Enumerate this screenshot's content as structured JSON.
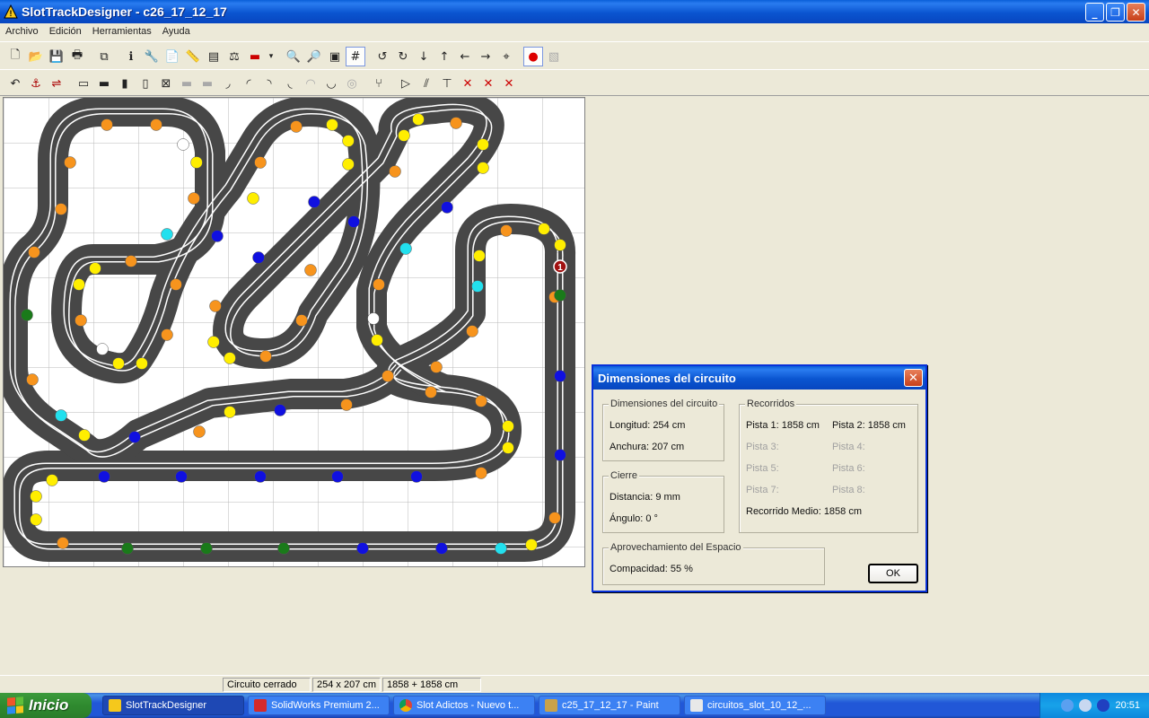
{
  "window": {
    "title": "SlotTrackDesigner - c26_17_12_17"
  },
  "menu": [
    "Archivo",
    "Edición",
    "Herramientas",
    "Ayuda"
  ],
  "toolbar1": [
    "new-file",
    "open-folder",
    "save",
    "print",
    "copy",
    "info",
    "tools",
    "document",
    "ruler",
    "palette",
    "scale",
    "battery",
    "zoom-out",
    "zoom-in",
    "fit-page",
    "grid",
    "rotate-left",
    "rotate-right",
    "arrow-down",
    "arrow-up",
    "arrow-left",
    "arrow-right",
    "target",
    "color-pieces",
    "texture"
  ],
  "toolbar2": [
    "undo",
    "anchor",
    "lane-changer",
    "straight-1",
    "straight-2",
    "straight-3",
    "straight-4",
    "crossing",
    "straight-gray-1",
    "straight-gray-2",
    "curve-1",
    "curve-2",
    "curve-3",
    "curve-4",
    "curve-5",
    "curve-6",
    "fork",
    "chicane",
    "border",
    "rail",
    "cross-out-1",
    "cross-out-2",
    "cross-out-3"
  ],
  "statusbar": {
    "state": "Circuito cerrado",
    "size": "254 x 207 cm",
    "length": "1858 + 1858 cm"
  },
  "dialog": {
    "title": "Dimensiones del circuito",
    "dims_group": "Dimensiones del circuito",
    "longitud": "Longitud: 254 cm",
    "anchura": "Anchura: 207 cm",
    "cierre_group": "Cierre",
    "distancia": "Distancia: 9 mm",
    "angulo": "Ángulo: 0 °",
    "recorridos_group": "Recorridos",
    "pista1": "Pista 1: 1858 cm",
    "pista2": "Pista 2: 1858 cm",
    "pista3": "Pista 3:",
    "pista4": "Pista 4:",
    "pista5": "Pista 5:",
    "pista6": "Pista 6:",
    "pista7": "Pista 7:",
    "pista8": "Pista 8:",
    "medio": "Recorrido Medio: 1858 cm",
    "espacio_group": "Aprovechamiento del Espacio",
    "compacidad": "Compacidad: 55 %",
    "ok": "OK"
  },
  "track": {
    "lap_marker": "1",
    "colors": {
      "track": "#474747",
      "lane": "#ffffff",
      "orange": "#f7941d",
      "yellow": "#ffee00",
      "blue": "#1010e0",
      "cyan": "#22e0ee",
      "green": "#1a7a1a",
      "white": "#ffffff"
    }
  },
  "taskbar": {
    "start": "Inicio",
    "tasks": [
      "SlotTrackDesigner",
      "SolidWorks Premium 2...",
      "Slot Adictos - Nuevo t...",
      "c25_17_12_17 - Paint",
      "circuitos_slot_10_12_..."
    ],
    "clock": "20:51"
  }
}
